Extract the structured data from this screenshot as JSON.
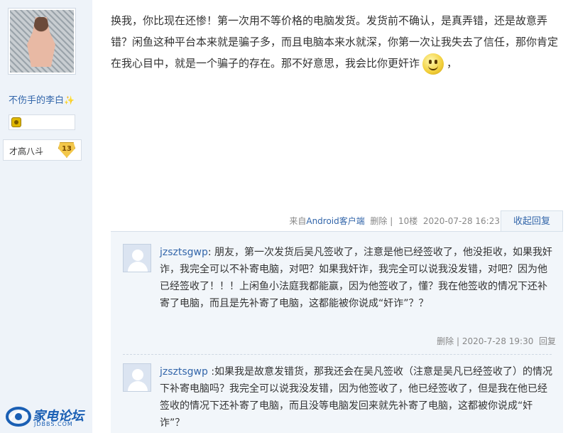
{
  "sidebar": {
    "username": "不伤手的李白",
    "sparkle": "✨",
    "level_label": "才高八斗",
    "level_number": "13"
  },
  "post": {
    "text_before_emoji": "换我，你比现在还惨！第一次用不等价格的电脑发货。发货前不确认，是真弄错，还是故意弄错？闲鱼这种平台本来就是骗子多，而且电脑本来水就深，你第一次让我失去了信任，那你肯定在我心目中，就是一个骗子的存在。那不好意思，我会比你更奸诈",
    "text_after_emoji": "，"
  },
  "meta": {
    "from_prefix": "来自",
    "client": "Android客户端",
    "delete": "删除",
    "sep": "|",
    "floor": "10楼",
    "time": "2020-07-28 16:23",
    "collapse_reply": "收起回复"
  },
  "replies": [
    {
      "user": "jzsztsgwp",
      "text": ": 朋友，第一次发货后吴凡签收了，注意是他已经签收了，他没拒收，如果我奸诈，我完全可以不补寄电脑，对吧？如果我奸诈，我完全可以说我没发错，对吧？因为他已经签收了！！！上闲鱼小法庭我都能赢，因为他签收了，懂？我在他签收的情况下还补寄了电脑，而且是先补寄了电脑，这都能被你说成“奸诈”？？",
      "delete": "删除",
      "sep": "|",
      "time": "2020-7-28 19:30",
      "reply": "回复"
    },
    {
      "user": "jzsztsgwp",
      "text": " :如果我是故意发错货，那我还会在吴凡签收（注意是吴凡已经签收了）的情况下补寄电脑吗？我完全可以说我没发错，因为他签收了，他已经签收了，但是我在他已经签收的情况下还补寄了电脑，而且没等电脑发回来就先补寄了电脑，这都被你说成“奸诈”？"
    }
  ],
  "logo": {
    "text": "家电论坛",
    "sub": "JDBBS.COM"
  }
}
